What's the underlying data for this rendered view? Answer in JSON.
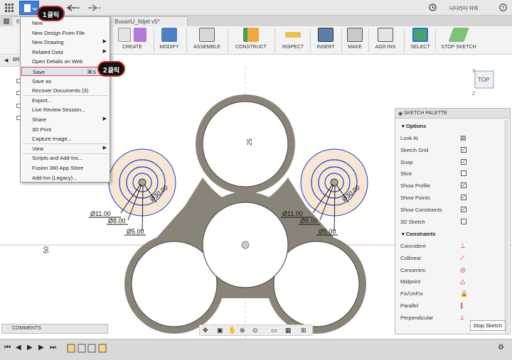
{
  "topbar": {
    "user_name": "나다라다 아하",
    "help_icon": "help-icon",
    "clock_icon": "history-icon"
  },
  "doc_tabs": [
    {
      "label": "fi"
    },
    {
      "label": "BusanU_fidjet v5*"
    }
  ],
  "toolbar": {
    "create": "CREATE",
    "modify": "MODIFY",
    "assemble": "ASSEMBLE",
    "construct": "CONSTRUCT",
    "inspect": "INSPECT",
    "insert": "INSERT",
    "make": "MAKE",
    "add_ins": "ADD-INS",
    "select": "SELECT",
    "stop_sketch": "STOP SKETCH"
  },
  "browser": {
    "label": "BR"
  },
  "file_menu": {
    "items": [
      {
        "label": "New",
        "arrow": false,
        "shortcut": ""
      },
      {
        "label": "New Design From File",
        "arrow": false,
        "shortcut": ""
      },
      {
        "label": "New Drawing",
        "arrow": true,
        "shortcut": ""
      },
      {
        "label": "Related Data",
        "arrow": true,
        "shortcut": ""
      },
      {
        "label": "Open Details on Web",
        "arrow": false,
        "shortcut": ""
      },
      {
        "label": "Save",
        "arrow": false,
        "shortcut": "⌘S"
      },
      {
        "label": "Save as",
        "arrow": false,
        "shortcut": ""
      },
      {
        "label": "Recover Documents (3)",
        "arrow": false,
        "shortcut": ""
      },
      {
        "label": "Export...",
        "arrow": false,
        "shortcut": ""
      },
      {
        "label": "Live Review Session...",
        "arrow": false,
        "shortcut": ""
      },
      {
        "label": "Share",
        "arrow": true,
        "shortcut": ""
      },
      {
        "label": "3D Print",
        "arrow": false,
        "shortcut": ""
      },
      {
        "label": "Capture Image...",
        "arrow": false,
        "shortcut": ""
      },
      {
        "label": "View",
        "arrow": true,
        "shortcut": ""
      },
      {
        "label": "Scripts and Add-Ins...",
        "arrow": false,
        "shortcut": ""
      },
      {
        "label": "Fusion 360 App Store",
        "arrow": false,
        "shortcut": ""
      },
      {
        "label": "Add-Ins (Legacy)...",
        "arrow": false,
        "shortcut": ""
      }
    ]
  },
  "annotations": {
    "step1": {
      "num": "1",
      "text": "클릭"
    },
    "step2": {
      "num": "2",
      "text": "클릭"
    }
  },
  "sketch": {
    "dim_25": "25",
    "dim_50": "50",
    "left": {
      "d11": "Ø11.00",
      "d8": "Ø8.00",
      "d5": "Ø5.00",
      "d30": "Ø30.00"
    },
    "right": {
      "d11": "Ø11.00",
      "d8": "Ø8.00",
      "d5": "Ø5.00",
      "d30": "Ø30.00"
    }
  },
  "viewcube": {
    "face": "TOP",
    "axis_x": "X",
    "axis_z": "Z"
  },
  "palette": {
    "title": "SKETCH PALETTE",
    "options_title": "Options",
    "options": [
      {
        "label": "Look At",
        "type": "icon",
        "checked": false
      },
      {
        "label": "Sketch Grid",
        "type": "check",
        "checked": true
      },
      {
        "label": "Snap",
        "type": "check",
        "checked": true
      },
      {
        "label": "Slice",
        "type": "check",
        "checked": false
      },
      {
        "label": "Show Profile",
        "type": "check",
        "checked": true
      },
      {
        "label": "Show Points",
        "type": "check",
        "checked": true
      },
      {
        "label": "Show Constraints",
        "type": "check",
        "checked": true
      },
      {
        "label": "3D Sketch",
        "type": "check",
        "checked": false
      }
    ],
    "constraints_title": "Constraints",
    "constraints": [
      {
        "label": "Coincident",
        "icon": "coincident-icon"
      },
      {
        "label": "Collinear",
        "icon": "collinear-icon"
      },
      {
        "label": "Concentric",
        "icon": "concentric-icon"
      },
      {
        "label": "Midpoint",
        "icon": "midpoint-icon"
      },
      {
        "label": "Fix/UnFix",
        "icon": "lock-icon"
      },
      {
        "label": "Parallel",
        "icon": "parallel-icon"
      },
      {
        "label": "Perpendicular",
        "icon": "perpendicular-icon"
      }
    ],
    "stop_button": "Stop Sketch"
  },
  "comments": {
    "label": "COMMENTS"
  },
  "colors": {
    "accent": "#2a6fd6",
    "badge_border": "#c82828",
    "sketch_blue": "#1f3fd0",
    "fill": "#f6e6d2",
    "body": "#8a8478"
  }
}
